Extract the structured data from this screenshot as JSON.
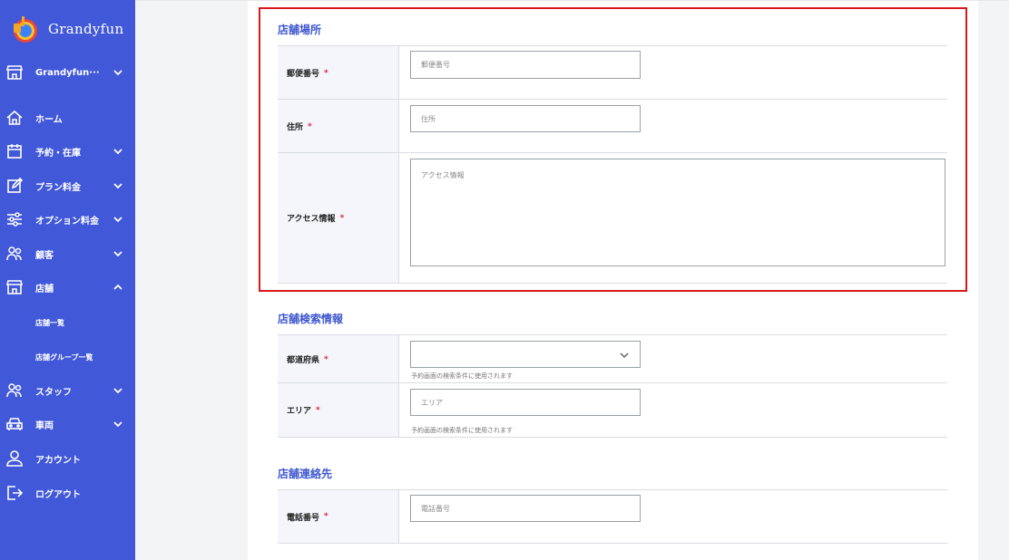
{
  "app": {
    "name": "Grandyfun"
  },
  "sidebar": {
    "store_selector": "Grandyfun···",
    "items": [
      {
        "label": "ホーム",
        "icon": "home-icon"
      },
      {
        "label": "予約・在庫",
        "icon": "calendar-icon"
      },
      {
        "label": "プラン料金",
        "icon": "edit-icon"
      },
      {
        "label": "オプション料金",
        "icon": "sliders-icon"
      },
      {
        "label": "顧客",
        "icon": "users-icon"
      },
      {
        "label": "店舗",
        "icon": "store-icon"
      },
      {
        "label": "スタッフ",
        "icon": "users-icon"
      },
      {
        "label": "車両",
        "icon": "car-icon"
      },
      {
        "label": "アカウント",
        "icon": "user-icon"
      },
      {
        "label": "ログアウト",
        "icon": "logout-icon"
      }
    ],
    "store_submenu": [
      "店舗一覧",
      "店舗グループ一覧"
    ]
  },
  "colors": {
    "sidebar": "#4158d8",
    "accent": "#3d56cf",
    "required": "#e0273a",
    "highlight": "#d91919"
  },
  "location": {
    "title": "店舗場所",
    "postal_label": "郵便番号",
    "postal_placeholder": "郵便番号",
    "address_label": "住所",
    "address_placeholder": "住所",
    "access_label": "アクセス情報",
    "access_placeholder": "アクセス情報"
  },
  "search": {
    "title": "店舗検索情報",
    "prefecture_label": "都道府県",
    "prefecture_value": "",
    "prefecture_help": "予約画面の検索条件に使用されます",
    "area_label": "エリア",
    "area_placeholder": "エリア",
    "area_help": "予約画面の検索条件に使用されます"
  },
  "contact": {
    "title": "店舗連絡先",
    "phone_label": "電話番号",
    "phone_placeholder": "電話番号"
  },
  "required_mark": "*"
}
